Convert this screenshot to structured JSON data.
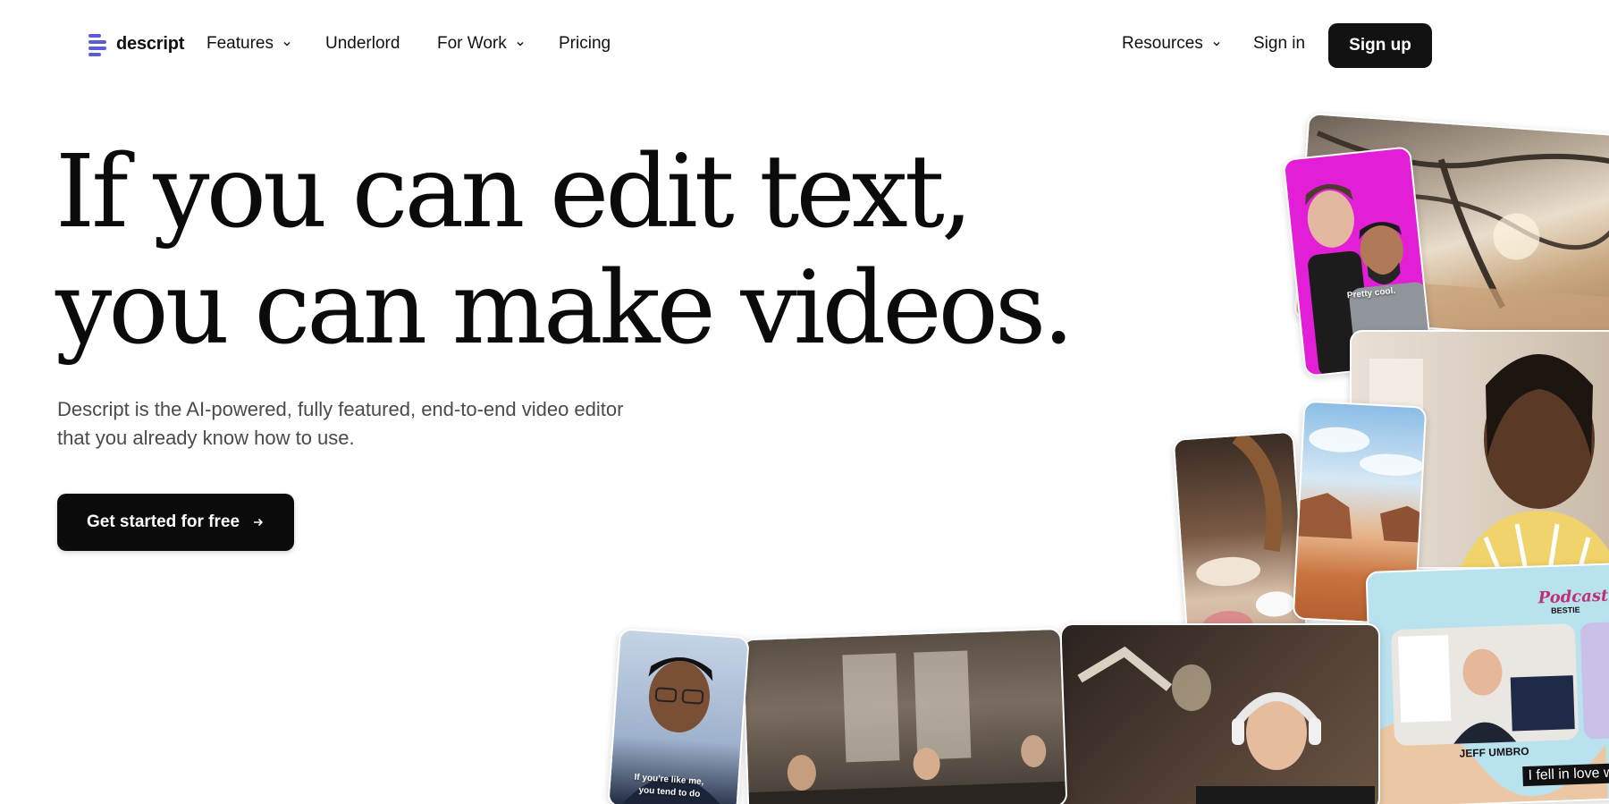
{
  "nav": {
    "brand": "descript",
    "items": [
      {
        "label": "Features",
        "dropdown": true
      },
      {
        "label": "Underlord",
        "dropdown": false
      },
      {
        "label": "For Work",
        "dropdown": true
      },
      {
        "label": "Pricing",
        "dropdown": false
      }
    ],
    "right": {
      "resources": "Resources",
      "signin": "Sign in",
      "signup": "Sign up"
    }
  },
  "hero": {
    "headline_line1": "If you can edit text,",
    "headline_line2": "you can make videos.",
    "subtitle_line1": "Descript is the AI-powered, fully featured, end-to-end video editor",
    "subtitle_line2": "that you already know how to use.",
    "cta": "Get started for free"
  },
  "collage": {
    "caption_pretty_cool": "Pretty cool.",
    "caption_if_youre": "If you're like me,",
    "caption_you_tend": "you tend to do",
    "caption_jeff": "JEFF UMBRO",
    "caption_fell": "I fell in love w",
    "podcast_logo": "Podcast",
    "podcast_logo_sub": "BESTIE"
  },
  "colors": {
    "brand_accent": "#5b5bd6",
    "primary_button": "#121212",
    "text_primary": "#0b0b0b",
    "text_secondary": "#4a4a4a"
  }
}
